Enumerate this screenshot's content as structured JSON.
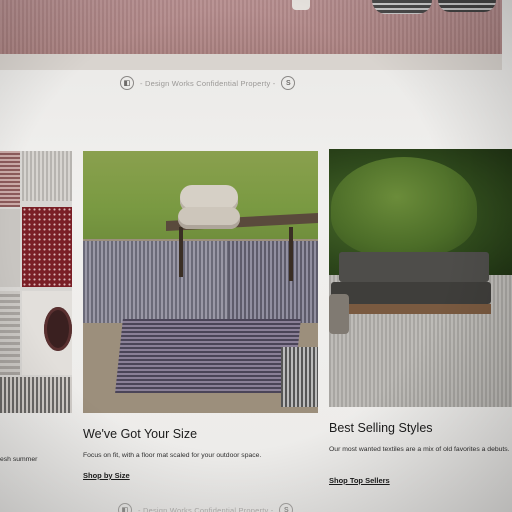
{
  "watermark": {
    "text": "- Design Works Confidential Property -"
  },
  "cards": [
    {
      "body": "esh summer"
    },
    {
      "title": "We've Got Your Size",
      "body": "Focus on fit, with a floor mat scaled for your outdoor space.",
      "link": "Shop by Size"
    },
    {
      "title": "Best Selling Styles",
      "body": "Our most wanted textiles are a mix of old favorites a debuts.",
      "link": "Shop Top Sellers"
    }
  ]
}
